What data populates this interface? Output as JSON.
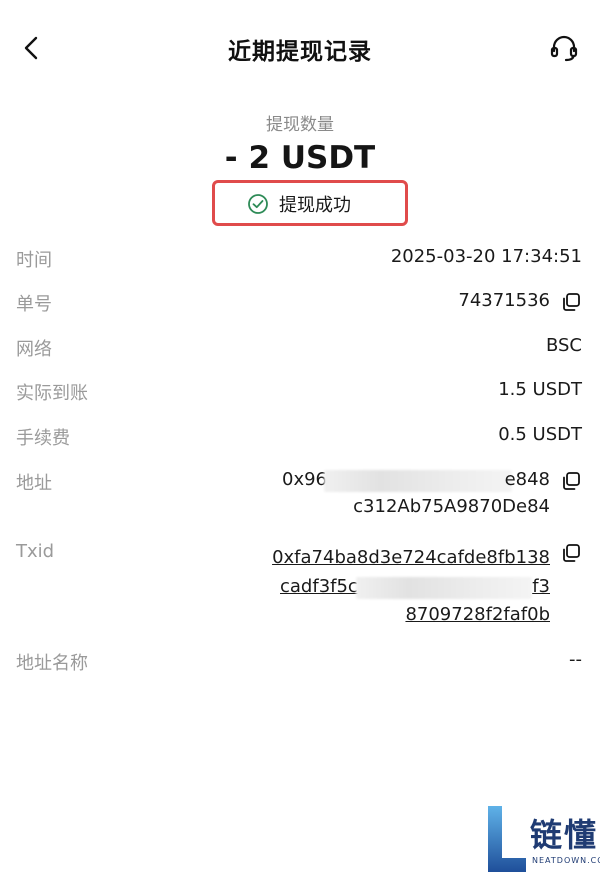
{
  "header": {
    "title": "近期提现记录",
    "back_icon": "chevron-left-icon",
    "support_icon": "headset-icon"
  },
  "summary": {
    "amount_label": "提现数量",
    "amount": "- 2 USDT",
    "status": "提现成功",
    "status_icon": "check-circle-icon",
    "status_color": "#2e8b57",
    "highlight_color": "#e04b4b"
  },
  "details": {
    "time": {
      "label": "时间",
      "value": "2025-03-20 17:34:51"
    },
    "order": {
      "label": "单号",
      "value": "74371536"
    },
    "network": {
      "label": "网络",
      "value": "BSC"
    },
    "received": {
      "label": "实际到账",
      "value": "1.5 USDT"
    },
    "fee": {
      "label": "手续费",
      "value": "0.5 USDT"
    },
    "address": {
      "label": "地址",
      "line1_start": "0x96",
      "line1_end": "e848",
      "line2": "c312Ab75A9870De84"
    },
    "txid": {
      "label": "Txid",
      "line1": "0xfa74ba8d3e724cafde8fb138",
      "line2_start": "cadf3f5c",
      "line2_end": "f3",
      "line3": "8709728f2faf0b"
    },
    "address_name": {
      "label": "地址名称",
      "value": "--"
    }
  },
  "watermark": {
    "text": "链懂",
    "sub": "NEATDOWN.COM"
  }
}
